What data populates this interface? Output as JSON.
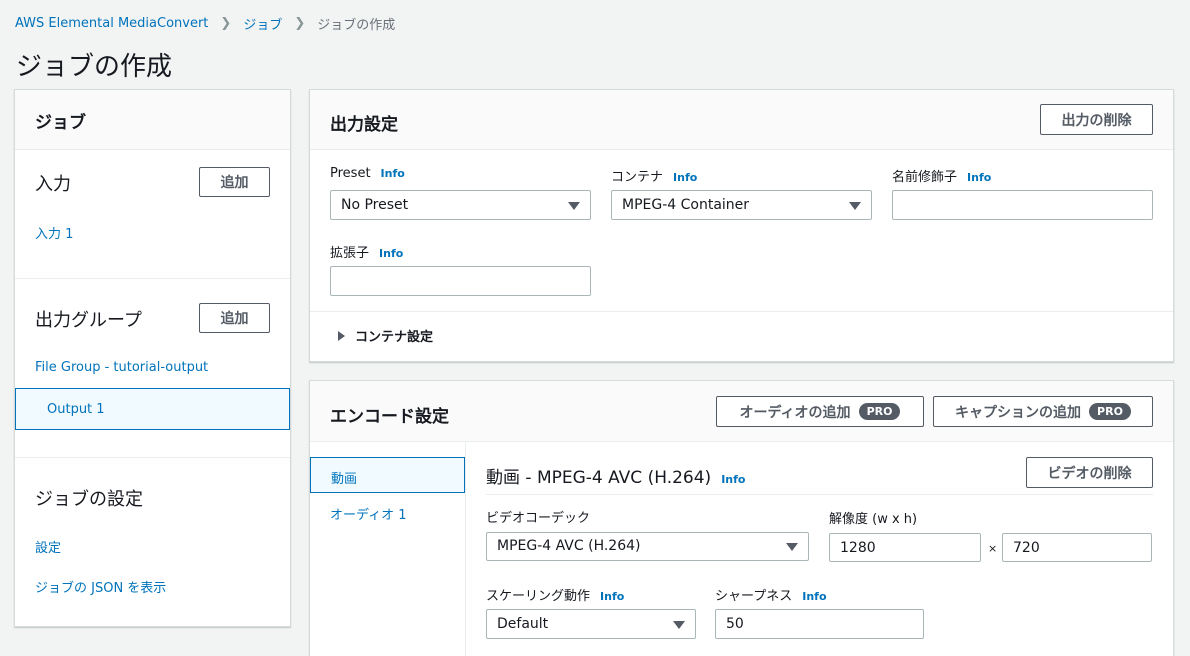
{
  "breadcrumb": {
    "root": "AWS Elemental MediaConvert",
    "jobs": "ジョブ",
    "current": "ジョブの作成"
  },
  "page_title": "ジョブの作成",
  "sidebar": {
    "title": "ジョブ",
    "inputs": {
      "heading": "入力",
      "add_label": "追加",
      "items": [
        "入力 1"
      ]
    },
    "output_groups": {
      "heading": "出力グループ",
      "add_label": "追加",
      "group_label": "File Group - tutorial-output",
      "outputs": [
        "Output 1"
      ]
    },
    "job_settings": {
      "heading": "ジョブの設定",
      "settings_link": "設定",
      "json_link": "ジョブの JSON を表示"
    }
  },
  "output_settings": {
    "title": "出力設定",
    "delete_label": "出力の削除",
    "info_label": "Info",
    "preset": {
      "label": "Preset",
      "value": "No Preset"
    },
    "container": {
      "label": "コンテナ",
      "value": "MPEG-4 Container"
    },
    "name_modifier": {
      "label": "名前修飾子",
      "value": ""
    },
    "extension": {
      "label": "拡張子",
      "value": ""
    },
    "container_settings_label": "コンテナ設定"
  },
  "encode_settings": {
    "title": "エンコード設定",
    "add_audio_label": "オーディオの追加",
    "add_caption_label": "キャプションの追加",
    "pro_badge": "PRO",
    "tabs": [
      "動画",
      "オーディオ 1"
    ],
    "video": {
      "title": "動画 - MPEG-4 AVC (H.264)",
      "info_label": "Info",
      "delete_label": "ビデオの削除",
      "codec": {
        "label": "ビデオコーデック",
        "value": "MPEG-4 AVC (H.264)"
      },
      "resolution": {
        "label": "解像度 (w x h)",
        "width": "1280",
        "height": "720",
        "separator": "×"
      },
      "scaling": {
        "label": "スケーリング動作",
        "value": "Default"
      },
      "sharpness": {
        "label": "シャープネス",
        "value": "50"
      }
    }
  },
  "colors": {
    "link": "#0073bb",
    "selected_bg": "#f1faff",
    "border": "#aab7b8",
    "pro_badge": "#545b64"
  }
}
